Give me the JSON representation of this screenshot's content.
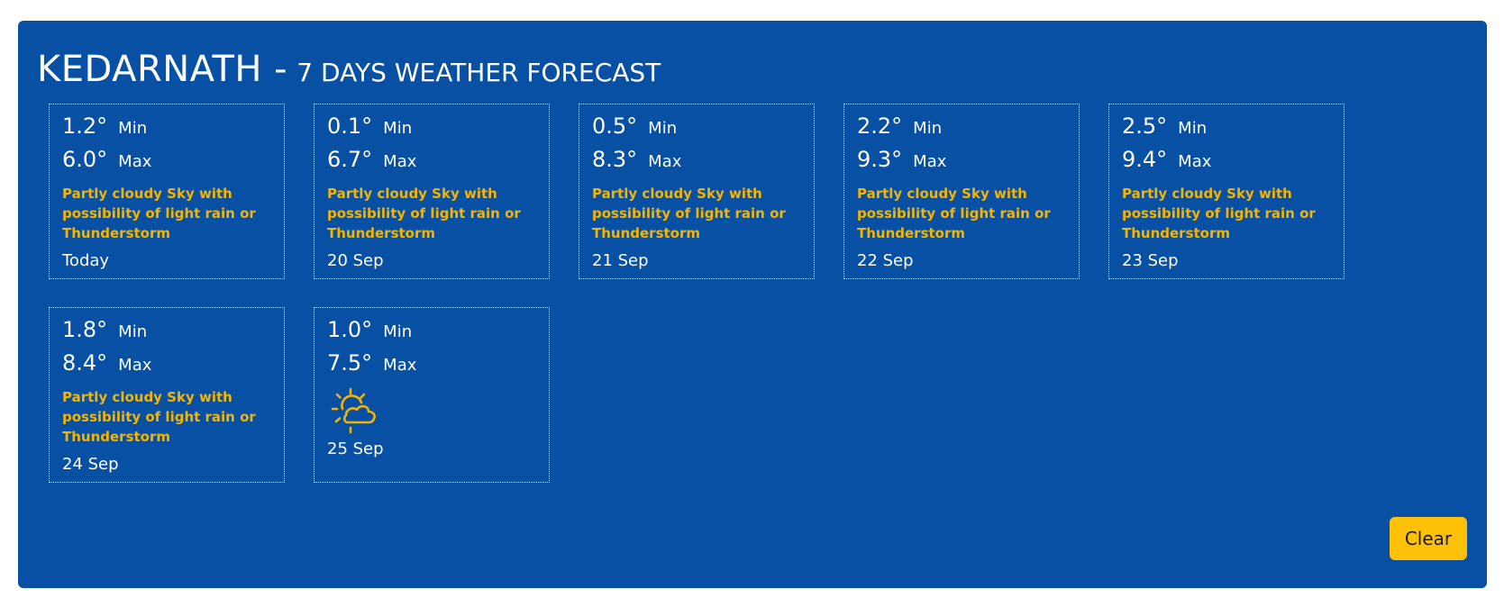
{
  "header": {
    "city": "KEDARNATH -",
    "subtitle": "7 DAYS WEATHER FORECAST"
  },
  "labels": {
    "min": "Min",
    "max": "Max"
  },
  "days": [
    {
      "min": "1.2°",
      "max": "6.0°",
      "description": "Partly cloudy Sky with possibility of light rain or Thunderstorm",
      "date": "Today"
    },
    {
      "min": "0.1°",
      "max": "6.7°",
      "description": "Partly cloudy Sky with possibility of light rain or Thunderstorm",
      "date": "20 Sep"
    },
    {
      "min": "0.5°",
      "max": "8.3°",
      "description": "Partly cloudy Sky with possibility of light rain or Thunderstorm",
      "date": "21 Sep"
    },
    {
      "min": "2.2°",
      "max": "9.3°",
      "description": "Partly cloudy Sky with possibility of light rain or Thunderstorm",
      "date": "22 Sep"
    },
    {
      "min": "2.5°",
      "max": "9.4°",
      "description": "Partly cloudy Sky with possibility of light rain or Thunderstorm",
      "date": "23 Sep"
    },
    {
      "min": "1.8°",
      "max": "8.4°",
      "description": "Partly cloudy Sky with possibility of light rain or Thunderstorm",
      "date": "24 Sep"
    },
    {
      "min": "1.0°",
      "max": "7.5°",
      "icon": "partly-cloudy-sun-icon",
      "date": "25 Sep"
    }
  ],
  "actions": {
    "clear_label": "Clear"
  },
  "colors": {
    "panel_background": "#0750a4",
    "accent_yellow": "#f5b400",
    "button_yellow": "#ffc107"
  }
}
